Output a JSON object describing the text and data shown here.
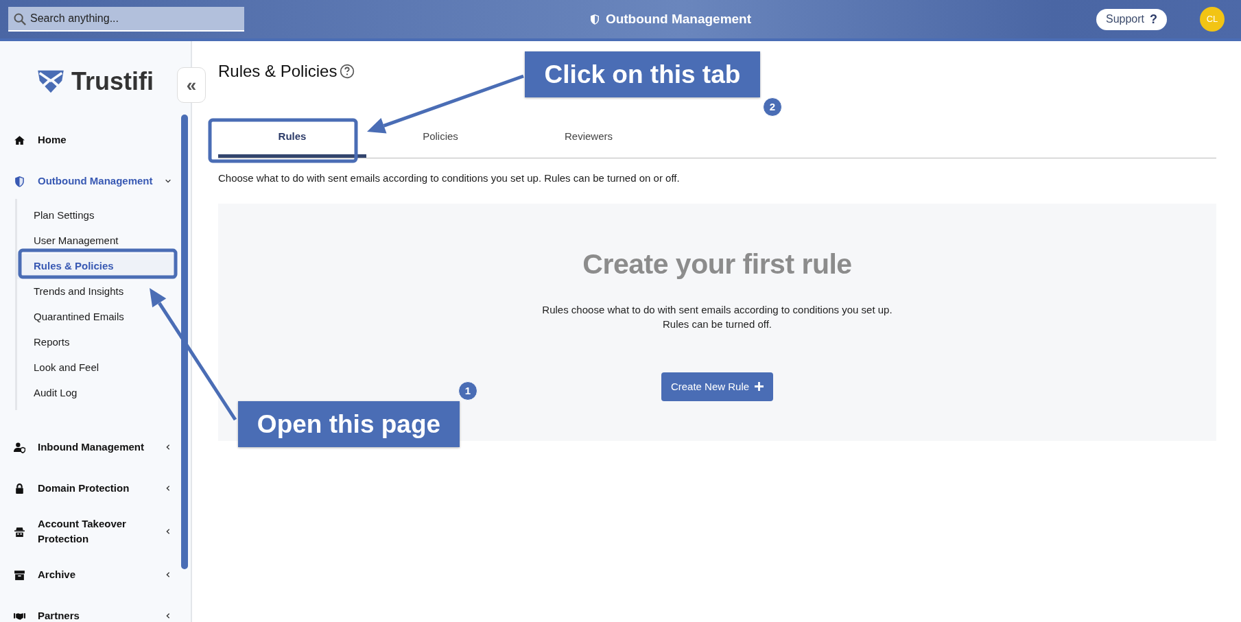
{
  "topbar": {
    "search": {
      "placeholder": "Search anything..."
    },
    "title": "Outbound Management",
    "support": {
      "label": "Support",
      "mark": "?"
    },
    "avatar": "CL"
  },
  "sidebar": {
    "logo_text": "Trustifi",
    "collapse_symbol": "«",
    "items": [
      {
        "label": "Home",
        "selected": false
      },
      {
        "label": "Outbound Management",
        "expanded": true,
        "selected": true,
        "children": [
          {
            "label": "Plan Settings",
            "selected": false
          },
          {
            "label": "User Management",
            "selected": false
          },
          {
            "label": "Rules & Policies",
            "selected": true
          },
          {
            "label": "Trends and Insights",
            "selected": false
          },
          {
            "label": "Quarantined Emails",
            "selected": false
          },
          {
            "label": "Reports",
            "selected": false
          },
          {
            "label": "Look and Feel",
            "selected": false
          },
          {
            "label": "Audit Log",
            "selected": false
          }
        ]
      },
      {
        "label": "Inbound Management",
        "expanded": false,
        "selected": false
      },
      {
        "label": "Domain Protection",
        "expanded": false,
        "selected": false
      },
      {
        "label": "Account Takeover Protection",
        "expanded": false,
        "selected": false
      },
      {
        "label": "Archive",
        "expanded": false,
        "selected": false
      },
      {
        "label": "Partners",
        "expanded": false,
        "selected": false
      }
    ]
  },
  "page": {
    "title": "Rules & Policies",
    "tabs": [
      {
        "label": "Rules",
        "selected": true
      },
      {
        "label": "Policies",
        "selected": false
      },
      {
        "label": "Reviewers",
        "selected": false
      }
    ],
    "description": "Choose what to do with sent emails according to conditions you set up. Rules can be turned on or off.",
    "empty_state": {
      "heading": "Create your first rule",
      "lines": [
        "Rules choose what to do with sent emails according to conditions you set up.",
        "Rules can be turned off."
      ],
      "button": "Create New Rule"
    }
  },
  "annotations": [
    {
      "text": "Click on this tab",
      "step": "2"
    },
    {
      "text": "Open this page",
      "step": "1"
    }
  ]
}
